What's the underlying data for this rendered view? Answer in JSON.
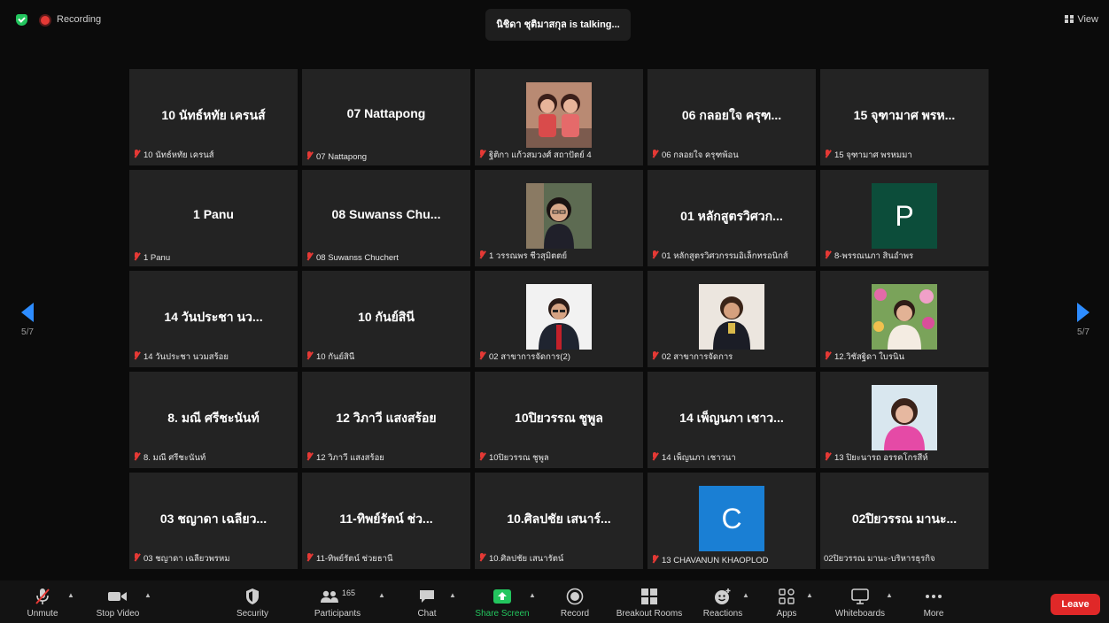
{
  "top_bar": {
    "recording_label": "Recording",
    "talking_text": "นิชิดา ชุติมาสกุล is talking...",
    "view_label": "View"
  },
  "pager": {
    "left_label": "5/7",
    "right_label": "5/7"
  },
  "tiles": [
    {
      "big": "10 นัทธ์หทัย เครนส์",
      "name": "10 นัทธ์หทัย เครนส์",
      "type": "text"
    },
    {
      "big": "07 Nattapong",
      "name": "07 Nattapong",
      "type": "text"
    },
    {
      "big": "",
      "name": "ฐิติกา แก้วสมวงศ์ สถาปัตย์ 4",
      "type": "photo",
      "photo": "two-kids-photo"
    },
    {
      "big": "06 กลอยใจ ครุฑ...",
      "name": "06 กลอยใจ ครุฑพ้อน",
      "type": "text"
    },
    {
      "big": "15 จุฑามาศ พรห...",
      "name": "15 จุฑามาศ พรหมมา",
      "type": "text"
    },
    {
      "big": "1 Panu",
      "name": "1 Panu",
      "type": "text"
    },
    {
      "big": "08 Suwanss Chu...",
      "name": "08 Suwanss Chuchert",
      "type": "text"
    },
    {
      "big": "",
      "name": "1 วรรณพร ชีวสุมิตตย์",
      "type": "photo",
      "photo": "woman-glasses-photo"
    },
    {
      "big": "01 หลักสูตรวิศวก...",
      "name": "01 หลักสูตรวิศวกรรมอิเล็กทรอนิกส์",
      "type": "text"
    },
    {
      "big": "",
      "name": "8-พรรณนภา สินอำพร",
      "type": "avatar",
      "letter": "P",
      "color": "#0c4d3a"
    },
    {
      "big": "14 วันประชา นว...",
      "name": "14 วันประชา นวมสร้อย",
      "type": "text"
    },
    {
      "big": "10 กันย์สินี",
      "name": "10 กันย์สินี",
      "type": "text"
    },
    {
      "big": "",
      "name": "02 สาขาการจัดการ(2)",
      "type": "photo",
      "photo": "man-suit-photo"
    },
    {
      "big": "",
      "name": "02 สาขาการจัดการ",
      "type": "photo",
      "photo": "woman-uniform-photo"
    },
    {
      "big": "",
      "name": "12.วิชัสฐิดา ใบรนิน",
      "type": "photo",
      "photo": "woman-flowers-photo"
    },
    {
      "big": "8. มณี ศรีชะนันท์",
      "name": "8. มณี ศรีชะนันท์",
      "type": "text"
    },
    {
      "big": "12 วิภาวี แสงสร้อย",
      "name": "12 วิภาวี แสงสร้อย",
      "type": "text"
    },
    {
      "big": "10ปิยวรรณ ชูพูล",
      "name": "10ปิยวรรณ ชูพูล",
      "type": "text"
    },
    {
      "big": "14 เพ็ญนภา เชาว...",
      "name": "14 เพ็ญนภา เชาวนา",
      "type": "text"
    },
    {
      "big": "",
      "name": "13 ปิยะนารถ อรรคโกรสีห์",
      "type": "photo",
      "photo": "woman-pink-photo"
    },
    {
      "big": "03 ชญาดา เฉลียว...",
      "name": "03 ชญาดา เฉลียวพรหม",
      "type": "text"
    },
    {
      "big": "11-ทิพย์รัตน์ ช่ว...",
      "name": "11-ทิพย์รัตน์ ช่วยธานี",
      "type": "text"
    },
    {
      "big": "10.ศิลปชัย เสนาร์...",
      "name": "10.ศิลปชัย เสนารัตน์",
      "type": "text"
    },
    {
      "big": "",
      "name": "13 CHAVANUN KHAOPLOD",
      "type": "avatar",
      "letter": "C",
      "color": "#1a7fd4"
    },
    {
      "big": "02ปิยวรรณ มานะ...",
      "name": "02ปิยวรรณ มานะ-บริหารธุรกิจ",
      "type": "text",
      "no_mic": true
    }
  ],
  "toolbar": {
    "unmute": "Unmute",
    "stop_video": "Stop Video",
    "security": "Security",
    "participants": "Participants",
    "participants_count": "165",
    "chat": "Chat",
    "share_screen": "Share Screen",
    "record": "Record",
    "breakout_rooms": "Breakout Rooms",
    "reactions": "Reactions",
    "apps": "Apps",
    "whiteboards": "Whiteboards",
    "more": "More",
    "leave": "Leave"
  },
  "colors": {
    "accent": "#2d8cff",
    "share_green": "#23c55e",
    "leave_red": "#e02828",
    "muted_red": "#e53935"
  }
}
